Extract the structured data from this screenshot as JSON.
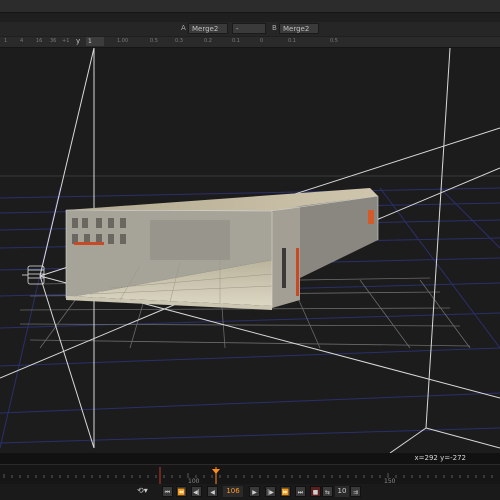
{
  "merge_bar": {
    "a_label": "A",
    "a_value": "Merge2",
    "mid_value": "-",
    "b_label": "B",
    "b_value": "Merge2"
  },
  "ruler": {
    "y_label": "y",
    "y_value": "1",
    "ticks": [
      "1",
      "4",
      "16",
      "36",
      "+1",
      "1.00",
      "0.5",
      "0.3",
      "0.2",
      "0.1",
      "0",
      "0.1",
      "0.5"
    ]
  },
  "viewer": {
    "coords": "x=292 y=-272"
  },
  "timeline": {
    "labels": [
      "100",
      "150"
    ],
    "playhead_frame": 106
  },
  "playback": {
    "frame": "106",
    "step": "10",
    "accent": "#ff8c1a"
  }
}
